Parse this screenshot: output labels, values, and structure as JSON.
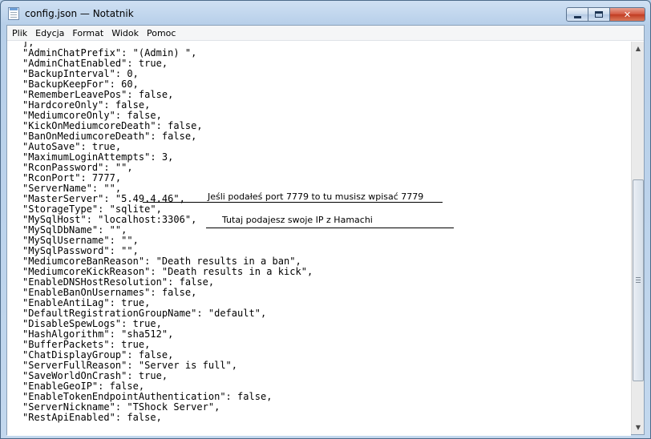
{
  "window": {
    "title": "config.json — Notatnik",
    "minimize_label": "minimize",
    "maximize_label": "maximize",
    "close_label": "✕"
  },
  "menu": [
    "Plik",
    "Edycja",
    "Format",
    "Widok",
    "Pomoc"
  ],
  "code_lines": [
    "],",
    "\"AdminChatPrefix\": \"(Admin) \",",
    "\"AdminChatEnabled\": true,",
    "\"BackupInterval\": 0,",
    "\"BackupKeepFor\": 60,",
    "\"RememberLeavePos\": false,",
    "\"HardcoreOnly\": false,",
    "\"MediumcoreOnly\": false,",
    "\"KickOnMediumcoreDeath\": false,",
    "\"BanOnMediumcoreDeath\": false,",
    "\"AutoSave\": true,",
    "\"MaximumLoginAttempts\": 3,",
    "\"RconPassword\": \"\",",
    "\"RconPort\": 7777,",
    "\"ServerName\": \"\",",
    "\"MasterServer\": \"5.49.4.46\",",
    "\"StorageType\": \"sqlite\",",
    "\"MySqlHost\": \"localhost:3306\",",
    "\"MySqlDbName\": \"\",",
    "\"MySqlUsername\": \"\",",
    "\"MySqlPassword\": \"\",",
    "\"MediumcoreBanReason\": \"Death results in a ban\",",
    "\"MediumcoreKickReason\": \"Death results in a kick\",",
    "\"EnableDNSHostResolution\": false,",
    "\"EnableBanOnUsernames\": false,",
    "\"EnableAntiLag\": true,",
    "\"DefaultRegistrationGroupName\": \"default\",",
    "\"DisableSpewLogs\": true,",
    "\"HashAlgorithm\": \"sha512\",",
    "\"BufferPackets\": true,",
    "\"ChatDisplayGroup\": false,",
    "\"ServerFullReason\": \"Server is full\",",
    "\"SaveWorldOnCrash\": true,",
    "\"EnableGeoIP\": false,",
    "\"EnableTokenEndpointAuthentication\": false,",
    "\"ServerNickname\": \"TShock Server\",",
    "\"RestApiEnabled\": false,"
  ],
  "annotations": {
    "port_note": "Jeśli podałeś port 7779 to tu musisz wpisać 7779",
    "ip_note": "Tutaj podajesz swoje IP z Hamachi"
  },
  "scrollbar": {
    "up_arrow": "▲",
    "down_arrow": "▼",
    "position": 0.43
  }
}
